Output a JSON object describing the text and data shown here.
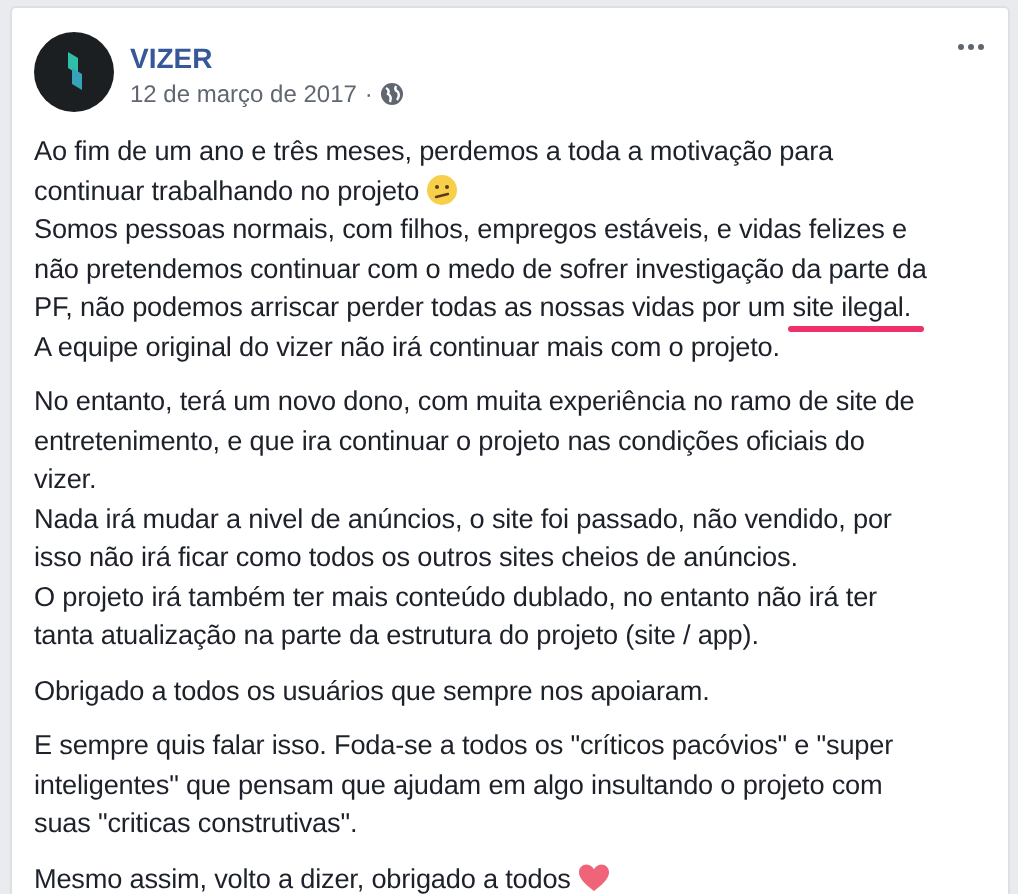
{
  "post": {
    "author": "VIZER",
    "date": "12 de março de 2017",
    "separator": "·",
    "paragraphs": [
      {
        "lines": [
          [
            {
              "text": "Ao fim de um ano e três meses, perdemos a toda a motivação para"
            }
          ],
          [
            {
              "text": "continuar trabalhando no projeto "
            },
            {
              "kind": "emoji-confused"
            }
          ],
          [
            {
              "text": "Somos pessoas normais, com filhos, empregos estáveis, e vidas felizes e"
            }
          ],
          [
            {
              "text": "não pretendemos continuar com o medo de sofrer investigação da parte da"
            }
          ],
          [
            {
              "text": "PF, não podemos arriscar perder todas as nossas vidas por um "
            },
            {
              "text": "site ilegal.",
              "underlined": true
            }
          ],
          [
            {
              "text": "A equipe original do vizer não irá continuar mais com o projeto."
            }
          ]
        ]
      },
      {
        "lines": [
          [
            {
              "text": "No entanto, terá um novo dono, com muita experiência no ramo de site de"
            }
          ],
          [
            {
              "text": "entretenimento, e que ira continuar o projeto nas condições oficiais do"
            }
          ],
          [
            {
              "text": "vizer."
            }
          ],
          [
            {
              "text": "Nada irá mudar a nivel de anúncios, o site foi passado, não vendido, por"
            }
          ],
          [
            {
              "text": "isso não irá ficar como todos os outros sites cheios de anúncios."
            }
          ],
          [
            {
              "text": "O projeto irá também ter mais conteúdo dublado, no entanto não irá ter"
            }
          ],
          [
            {
              "text": "tanta atualização na parte da estrutura do projeto (site / app)."
            }
          ]
        ]
      },
      {
        "lines": [
          [
            {
              "text": "Obrigado a todos os usuários que sempre nos apoiaram."
            }
          ]
        ]
      },
      {
        "lines": [
          [
            {
              "text": "E sempre quis falar isso. Foda-se a todos os \"críticos pacóvios\" e \"super"
            }
          ],
          [
            {
              "text": "inteligentes\" que pensam que ajudam em algo insultando o projeto com"
            }
          ],
          [
            {
              "text": "suas \"criticas construtivas\"."
            }
          ]
        ]
      },
      {
        "lines": [
          [
            {
              "text": "Mesmo assim, volto a dizer, obrigado a todos "
            },
            {
              "kind": "emoji-heart"
            }
          ]
        ]
      }
    ]
  }
}
